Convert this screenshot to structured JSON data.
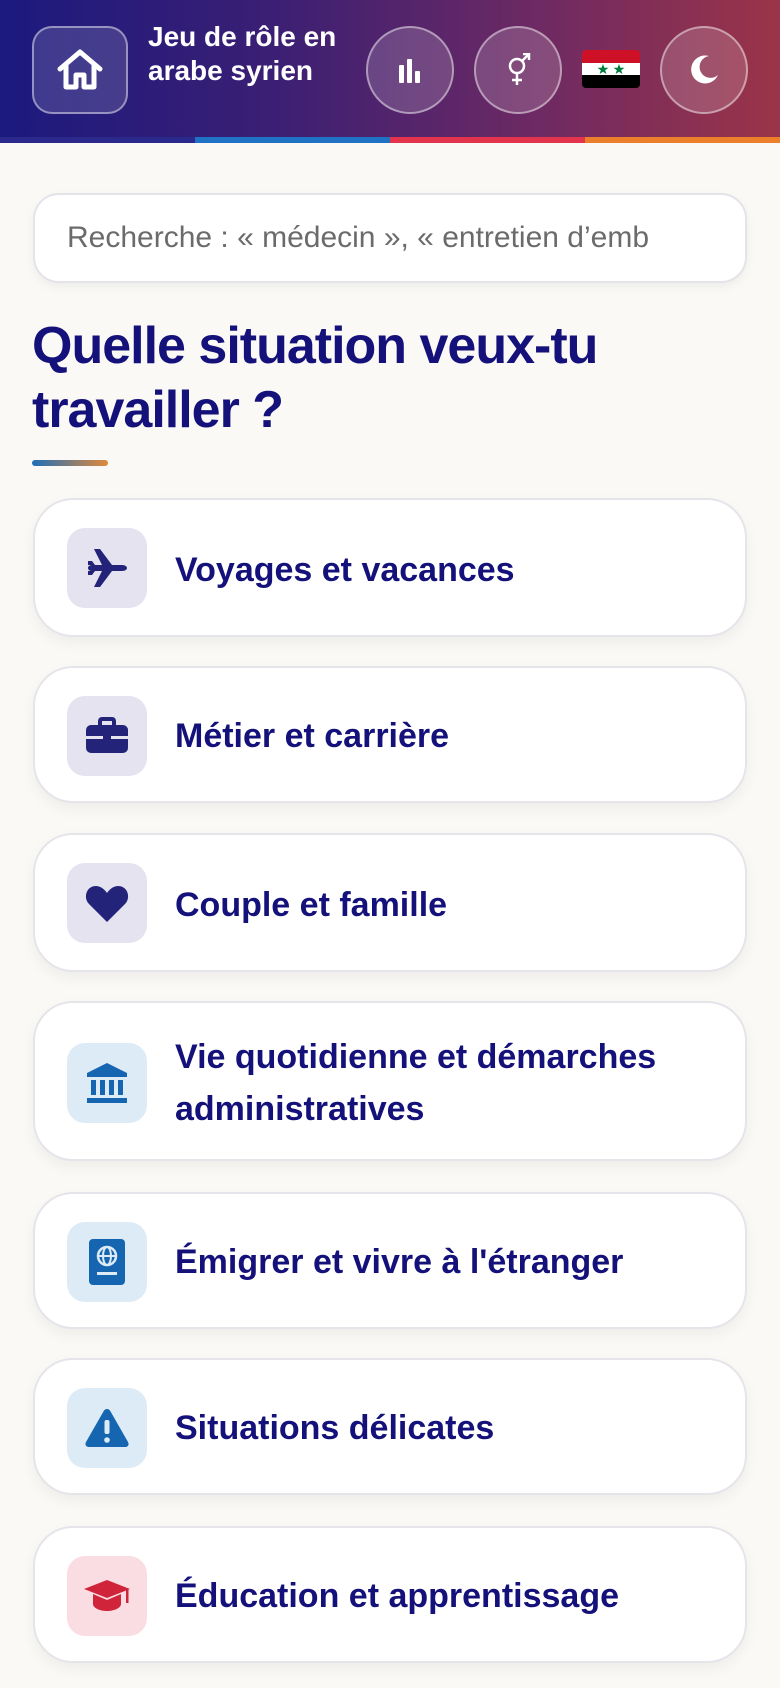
{
  "header": {
    "title": "Jeu de rôle en arabe syrien",
    "home_icon": "home-icon",
    "stats_icon": "bar-chart-icon",
    "gender_icon": "gender-icon",
    "flag_icon": "syria-flag-icon",
    "theme_icon": "moon-icon",
    "stripe_colors": [
      "#2b2a8c",
      "#1f72c4",
      "#e2354d",
      "#ec7f2c"
    ],
    "flag_colors": [
      "#ce1126",
      "#ffffff",
      "#000000"
    ],
    "flag_star_color": "#007a3d"
  },
  "search": {
    "placeholder": "Recherche : « médecin », « entretien d’emb"
  },
  "main": {
    "heading": "Quelle situation veux-tu travailler ?",
    "categories": [
      {
        "label": "Voyages et vacances",
        "icon": "airplane-icon",
        "icon_color": "#23237a",
        "icon_bg": "#e4e3ef"
      },
      {
        "label": "Métier et carrière",
        "icon": "briefcase-icon",
        "icon_color": "#23237a",
        "icon_bg": "#e4e3ef"
      },
      {
        "label": "Couple et famille",
        "icon": "heart-icon",
        "icon_color": "#23237a",
        "icon_bg": "#e4e3ef"
      },
      {
        "label": "Vie quotidienne et démarches administratives",
        "icon": "bank-icon",
        "icon_color": "#1565b0",
        "icon_bg": "#ddebf7"
      },
      {
        "label": "Émigrer et vivre à l'étranger",
        "icon": "passport-icon",
        "icon_color": "#1565b0",
        "icon_bg": "#ddebf7"
      },
      {
        "label": "Situations délicates",
        "icon": "warning-icon",
        "icon_color": "#1565b0",
        "icon_bg": "#ddebf7"
      },
      {
        "label": "Éducation et apprentissage",
        "icon": "graduation-cap-icon",
        "icon_color": "#d0243a",
        "icon_bg": "#f9dde2"
      }
    ]
  }
}
